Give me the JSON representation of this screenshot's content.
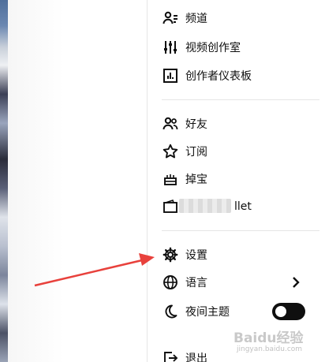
{
  "menu": {
    "items": [
      {
        "label": "频道",
        "icon": "channel-icon"
      },
      {
        "label": "视频创作室",
        "icon": "studio-sliders-icon"
      },
      {
        "label": "创作者仪表板",
        "icon": "dashboard-icon"
      },
      {
        "label": "好友",
        "icon": "friends-icon"
      },
      {
        "label": "订阅",
        "icon": "star-icon"
      },
      {
        "label": "掉宝",
        "icon": "gift-icon"
      },
      {
        "label": "llet",
        "icon": "wallet-icon"
      },
      {
        "label": "设置",
        "icon": "gear-icon"
      },
      {
        "label": "语言",
        "icon": "globe-icon"
      },
      {
        "label": "夜间主题",
        "icon": "moon-icon"
      },
      {
        "label": "退出",
        "icon": "logout-icon"
      }
    ],
    "night_theme_enabled": false
  },
  "annotation": {
    "arrow_color": "#e8413c"
  },
  "watermark": {
    "brand": "Baidu经验",
    "site": "jingyan.baidu.com"
  }
}
